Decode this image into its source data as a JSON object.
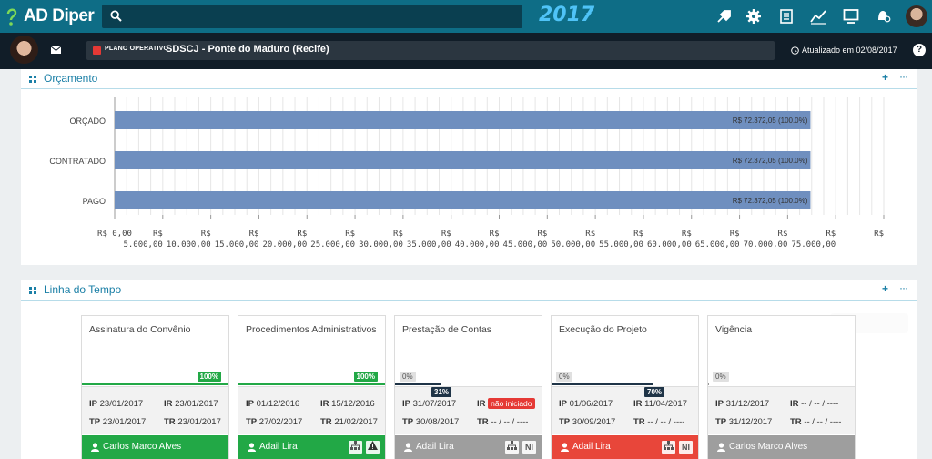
{
  "header": {
    "logo_text": "AD Diper",
    "year": "2017",
    "search_placeholder": "",
    "icons": [
      "rocket-icon",
      "gear-icon",
      "document-icon",
      "chart-line-icon",
      "monitor-icon",
      "notification-icon"
    ]
  },
  "subheader": {
    "plan_label": "PLANO OPERATIVO",
    "plan_name": "SDSCJ - Ponte do Maduro (Recife)",
    "updated": "Atualizado em 02/08/2017",
    "help": "?"
  },
  "budget_panel": {
    "title": "Orçamento",
    "plus": "+",
    "more": "···"
  },
  "chart_data": {
    "type": "bar",
    "orientation": "horizontal",
    "categories": [
      "ORÇADO",
      "CONTRATADO",
      "PAGO"
    ],
    "values": [
      72372.05,
      72372.05,
      72372.05
    ],
    "data_labels": [
      "R$ 72.372,05 (100.0%)",
      "R$ 72.372,05 (100.0%)",
      "R$ 72.372,05 (100.0%)"
    ],
    "x_ticks": [
      "R$ 0,00",
      "R$ 5.000,00",
      "R$ 10.000,00",
      "R$ 15.000,00",
      "R$ 20.000,00",
      "R$ 25.000,00",
      "R$ 30.000,00",
      "R$ 35.000,00",
      "R$ 40.000,00",
      "R$ 45.000,00",
      "R$ 50.000,00",
      "R$ 55.000,00",
      "R$ 60.000,00",
      "R$ 65.000,00",
      "R$ 70.000,00",
      "R$ 75.000,00",
      "R$"
    ],
    "x_tick_values": [
      0,
      5000,
      10000,
      15000,
      20000,
      25000,
      30000,
      35000,
      40000,
      45000,
      50000,
      55000,
      60000,
      65000,
      70000,
      75000,
      80000
    ],
    "xlim": [
      0,
      80000
    ],
    "bar_color": "#6f8fbf",
    "grid": true
  },
  "timeline_panel": {
    "title": "Linha do Tempo",
    "plus": "+",
    "more": "···",
    "cards": [
      {
        "title": "Assinatura do Convênio",
        "progress_label": "100%",
        "progress": 1.0,
        "color": "#22a846",
        "ip": "23/01/2017",
        "ir": "23/01/2017",
        "tp": "23/01/2017",
        "tr": "23/01/2017",
        "ir_badge": "",
        "user": "Carlos Marco Alves",
        "footer_color": "#22a846",
        "footer_icons": []
      },
      {
        "title": "Procedimentos Administrativos",
        "progress_label": "100%",
        "progress": 1.0,
        "color": "#22a846",
        "ip": "01/12/2016",
        "ir": "15/12/2016",
        "tp": "27/02/2017",
        "tr": "21/02/2017",
        "ir_badge": "",
        "user": "Adail Lira",
        "footer_color": "#22a846",
        "footer_icons": [
          "hierarchy-icon",
          "warning-icon"
        ]
      },
      {
        "title": "Prestação de Contas",
        "progress_label": "0%",
        "progress": 0.0,
        "color": "#999999",
        "sub_label": "31%",
        "ip": "31/07/2017",
        "ir": "",
        "tp": "30/08/2017",
        "tr": "-- / -- / ----",
        "ir_badge": "não iniciado",
        "user": "Adail Lira",
        "footer_color": "#9e9e9e",
        "footer_icons": [
          "hierarchy-icon"
        ],
        "footer_tag": "NI"
      },
      {
        "title": "Execução do Projeto",
        "progress_label": "0%",
        "progress": 0.0,
        "color": "#999999",
        "sub_label": "70%",
        "ip": "01/06/2017",
        "ir": "11/04/2017",
        "tp": "30/09/2017",
        "tr": "-- / -- / ----",
        "ir_badge": "",
        "user": "Adail Lira",
        "footer_color": "#e8463a",
        "footer_icons": [
          "hierarchy-icon"
        ],
        "footer_tag": "NI"
      },
      {
        "title": "Vigência",
        "progress_label": "0%",
        "progress": 0.0,
        "color": "#999999",
        "ip": "31/12/2017",
        "ir": "-- / -- / ----",
        "tp": "31/12/2017",
        "tr": "-- / -- / ----",
        "ir_badge": "",
        "user": "Carlos Marco Alves",
        "footer_color": "#9e9e9e",
        "footer_icons": []
      }
    ]
  },
  "labels": {
    "ip": "IP",
    "ir": "IR",
    "tp": "TP",
    "tr": "TR"
  }
}
